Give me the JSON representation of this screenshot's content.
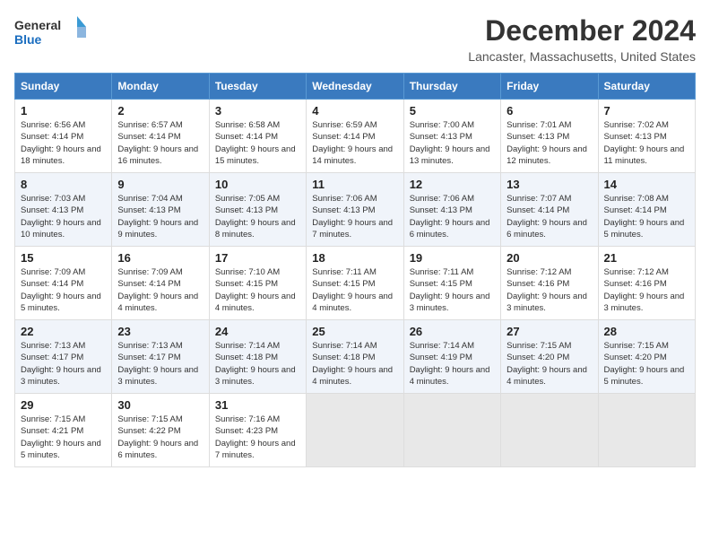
{
  "logo": {
    "line1": "General",
    "line2": "Blue"
  },
  "title": "December 2024",
  "location": "Lancaster, Massachusetts, United States",
  "days_of_week": [
    "Sunday",
    "Monday",
    "Tuesday",
    "Wednesday",
    "Thursday",
    "Friday",
    "Saturday"
  ],
  "weeks": [
    [
      {
        "day": "1",
        "sunrise": "6:56 AM",
        "sunset": "4:14 PM",
        "daylight": "9 hours and 18 minutes."
      },
      {
        "day": "2",
        "sunrise": "6:57 AM",
        "sunset": "4:14 PM",
        "daylight": "9 hours and 16 minutes."
      },
      {
        "day": "3",
        "sunrise": "6:58 AM",
        "sunset": "4:14 PM",
        "daylight": "9 hours and 15 minutes."
      },
      {
        "day": "4",
        "sunrise": "6:59 AM",
        "sunset": "4:14 PM",
        "daylight": "9 hours and 14 minutes."
      },
      {
        "day": "5",
        "sunrise": "7:00 AM",
        "sunset": "4:13 PM",
        "daylight": "9 hours and 13 minutes."
      },
      {
        "day": "6",
        "sunrise": "7:01 AM",
        "sunset": "4:13 PM",
        "daylight": "9 hours and 12 minutes."
      },
      {
        "day": "7",
        "sunrise": "7:02 AM",
        "sunset": "4:13 PM",
        "daylight": "9 hours and 11 minutes."
      }
    ],
    [
      {
        "day": "8",
        "sunrise": "7:03 AM",
        "sunset": "4:13 PM",
        "daylight": "9 hours and 10 minutes."
      },
      {
        "day": "9",
        "sunrise": "7:04 AM",
        "sunset": "4:13 PM",
        "daylight": "9 hours and 9 minutes."
      },
      {
        "day": "10",
        "sunrise": "7:05 AM",
        "sunset": "4:13 PM",
        "daylight": "9 hours and 8 minutes."
      },
      {
        "day": "11",
        "sunrise": "7:06 AM",
        "sunset": "4:13 PM",
        "daylight": "9 hours and 7 minutes."
      },
      {
        "day": "12",
        "sunrise": "7:06 AM",
        "sunset": "4:13 PM",
        "daylight": "9 hours and 6 minutes."
      },
      {
        "day": "13",
        "sunrise": "7:07 AM",
        "sunset": "4:14 PM",
        "daylight": "9 hours and 6 minutes."
      },
      {
        "day": "14",
        "sunrise": "7:08 AM",
        "sunset": "4:14 PM",
        "daylight": "9 hours and 5 minutes."
      }
    ],
    [
      {
        "day": "15",
        "sunrise": "7:09 AM",
        "sunset": "4:14 PM",
        "daylight": "9 hours and 5 minutes."
      },
      {
        "day": "16",
        "sunrise": "7:09 AM",
        "sunset": "4:14 PM",
        "daylight": "9 hours and 4 minutes."
      },
      {
        "day": "17",
        "sunrise": "7:10 AM",
        "sunset": "4:15 PM",
        "daylight": "9 hours and 4 minutes."
      },
      {
        "day": "18",
        "sunrise": "7:11 AM",
        "sunset": "4:15 PM",
        "daylight": "9 hours and 4 minutes."
      },
      {
        "day": "19",
        "sunrise": "7:11 AM",
        "sunset": "4:15 PM",
        "daylight": "9 hours and 3 minutes."
      },
      {
        "day": "20",
        "sunrise": "7:12 AM",
        "sunset": "4:16 PM",
        "daylight": "9 hours and 3 minutes."
      },
      {
        "day": "21",
        "sunrise": "7:12 AM",
        "sunset": "4:16 PM",
        "daylight": "9 hours and 3 minutes."
      }
    ],
    [
      {
        "day": "22",
        "sunrise": "7:13 AM",
        "sunset": "4:17 PM",
        "daylight": "9 hours and 3 minutes."
      },
      {
        "day": "23",
        "sunrise": "7:13 AM",
        "sunset": "4:17 PM",
        "daylight": "9 hours and 3 minutes."
      },
      {
        "day": "24",
        "sunrise": "7:14 AM",
        "sunset": "4:18 PM",
        "daylight": "9 hours and 3 minutes."
      },
      {
        "day": "25",
        "sunrise": "7:14 AM",
        "sunset": "4:18 PM",
        "daylight": "9 hours and 4 minutes."
      },
      {
        "day": "26",
        "sunrise": "7:14 AM",
        "sunset": "4:19 PM",
        "daylight": "9 hours and 4 minutes."
      },
      {
        "day": "27",
        "sunrise": "7:15 AM",
        "sunset": "4:20 PM",
        "daylight": "9 hours and 4 minutes."
      },
      {
        "day": "28",
        "sunrise": "7:15 AM",
        "sunset": "4:20 PM",
        "daylight": "9 hours and 5 minutes."
      }
    ],
    [
      {
        "day": "29",
        "sunrise": "7:15 AM",
        "sunset": "4:21 PM",
        "daylight": "9 hours and 5 minutes."
      },
      {
        "day": "30",
        "sunrise": "7:15 AM",
        "sunset": "4:22 PM",
        "daylight": "9 hours and 6 minutes."
      },
      {
        "day": "31",
        "sunrise": "7:16 AM",
        "sunset": "4:23 PM",
        "daylight": "9 hours and 7 minutes."
      },
      null,
      null,
      null,
      null
    ]
  ]
}
